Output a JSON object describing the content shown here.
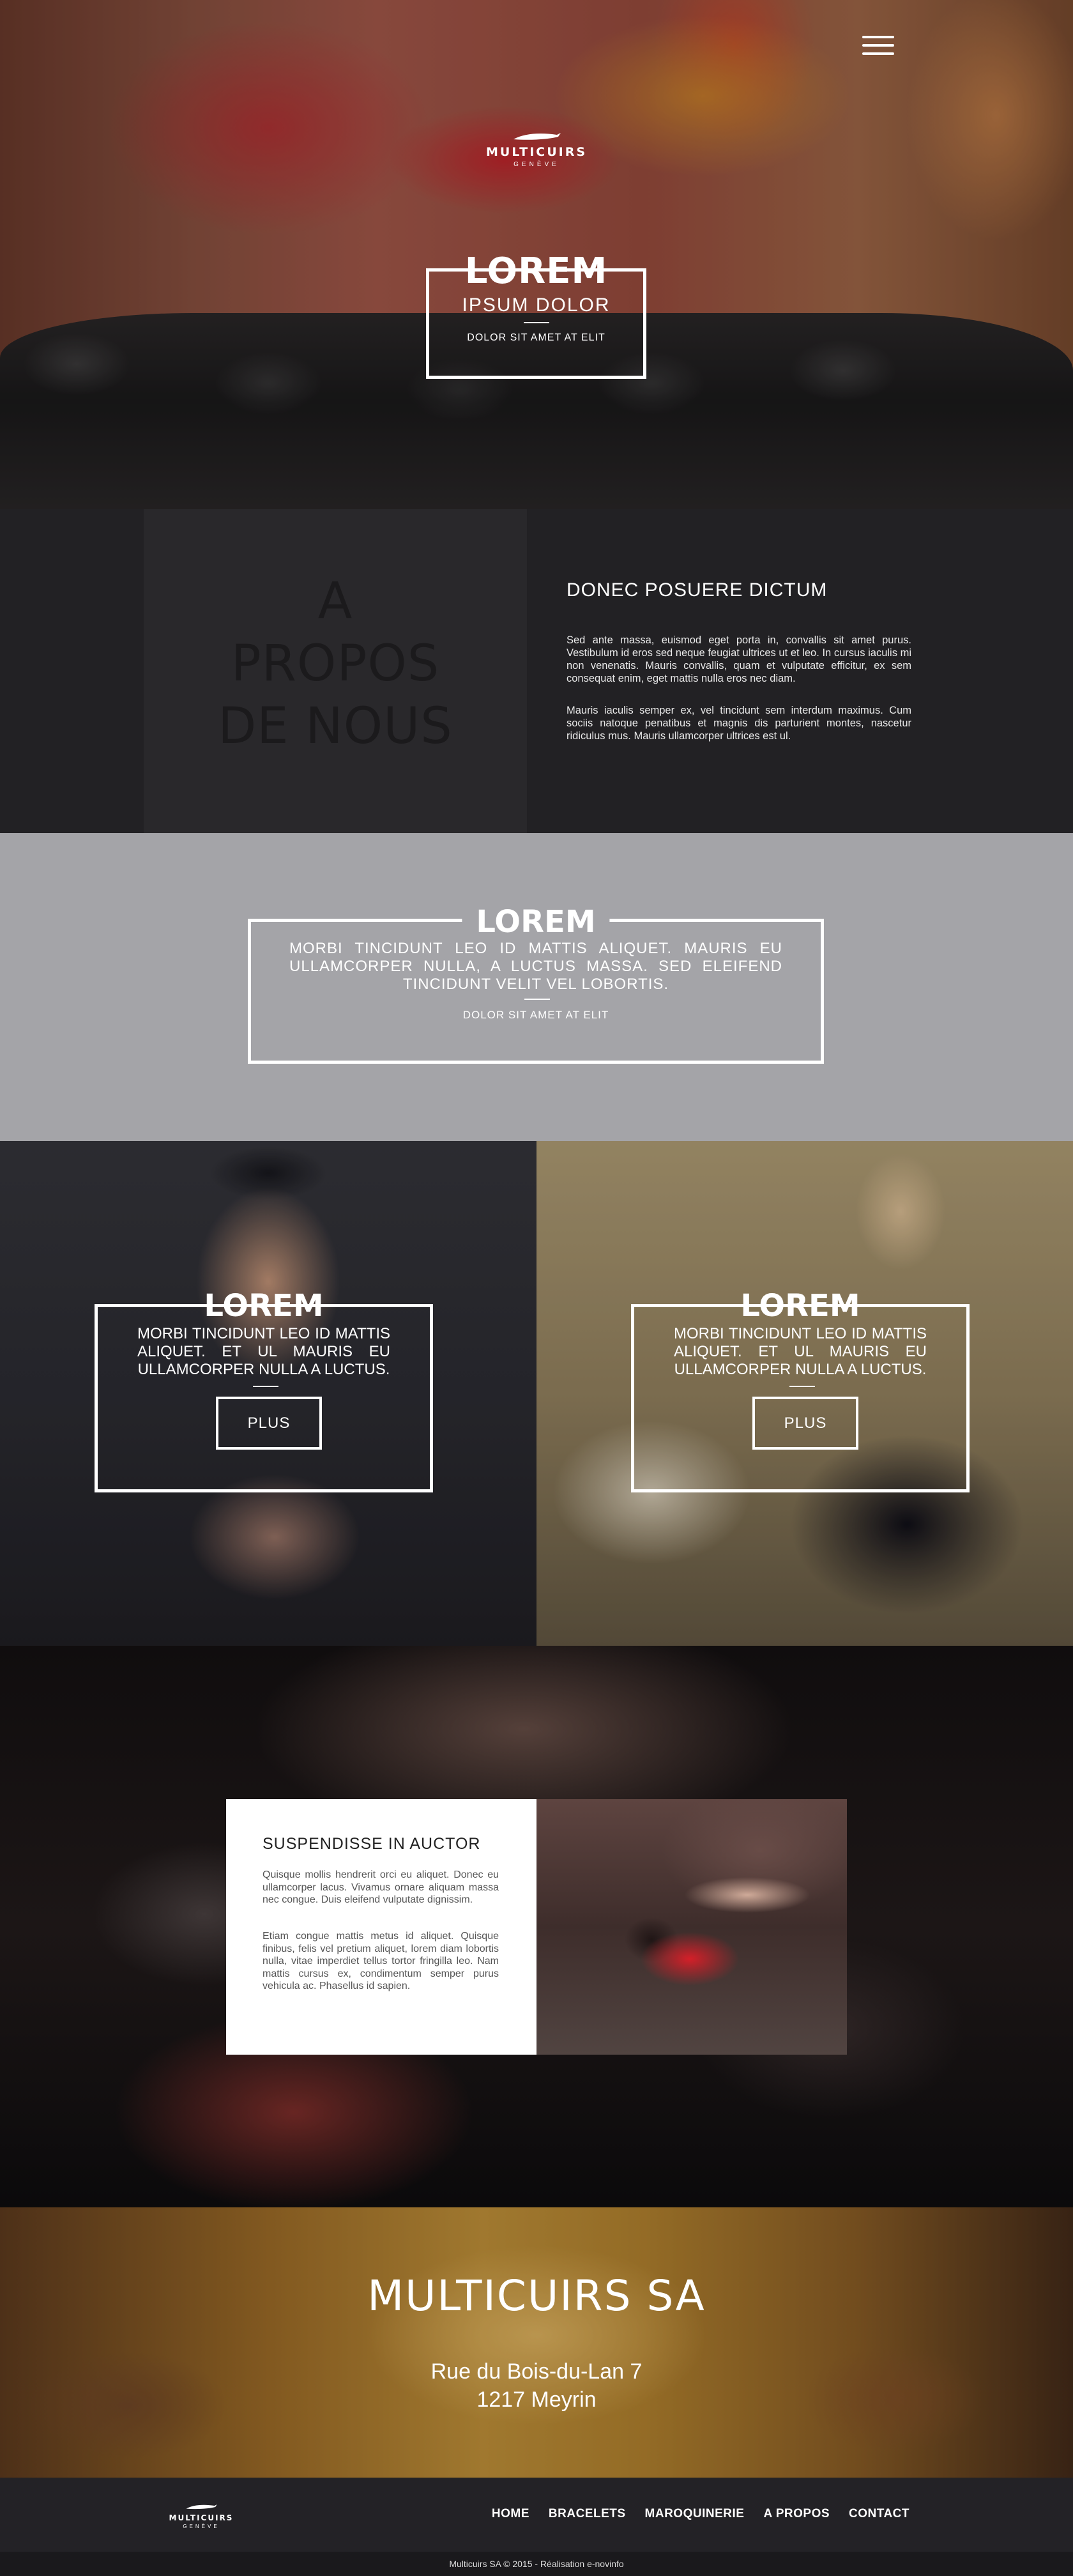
{
  "hero": {
    "menu_icon": "hamburger-icon",
    "logo_name": "MULTICUIRS",
    "logo_sub": "GENÈVE",
    "title": "LOREM",
    "subtitle": "IPSUM DOLOR",
    "caption": "DOLOR SIT AMET AT ELIT"
  },
  "about": {
    "big_text": [
      "A",
      "PROPOS",
      "DE NOUS"
    ],
    "heading": "DONEC POSUERE DICTUM",
    "paragraph1": "Sed ante massa, euismod eget porta in, convallis sit amet purus. Vestibulum id eros sed neque feugiat ultrices ut et leo. In cursus iaculis mi non venenatis. Mauris convallis, quam et vulputate efficitur, ex sem consequat enim, eget mattis nulla eros nec diam.",
    "paragraph2": "Mauris iaculis semper ex, vel tincidunt sem interdum maximus. Cum sociis natoque penatibus et magnis dis parturient montes, nascetur ridiculus mus. Mauris ullamcorper ultrices est ul."
  },
  "quote": {
    "title": "LOREM",
    "text": "MORBI TINCIDUNT LEO ID MATTIS ALIQUET. MAURIS EU ULLAMCORPER NULLA, A LUCTUS MASSA. SED ELEIFEND TINCIDUNT VELIT VEL LOBORTIS.",
    "caption": "DOLOR SIT AMET AT ELIT"
  },
  "tiles": [
    {
      "title": "LOREM",
      "text": "MORBI TINCIDUNT LEO ID MATTIS ALIQUET. ET UL MAURIS EU ULLAMCORPER NULLA A LUCTUS.",
      "button": "PLUS"
    },
    {
      "title": "LOREM",
      "text": "MORBI TINCIDUNT LEO ID MATTIS ALIQUET. ET UL MAURIS EU ULLAMCORPER NULLA A LUCTUS.",
      "button": "PLUS"
    }
  ],
  "article": {
    "heading": "SUSPENDISSE IN AUCTOR",
    "paragraph1": "Quisque mollis hendrerit orci eu aliquet. Donec eu ullamcorper lacus. Vivamus ornare aliquam massa nec congue. Duis eleifend vulputate dignissim.",
    "paragraph2": "Etiam congue mattis metus id aliquet. Quisque finibus, felis vel pretium aliquet, lorem diam lobortis nulla, vitae imperdiet tellus tortor fringilla leo. Nam mattis cursus ex, condimentum semper purus vehicula ac. Phasellus id sapien."
  },
  "contact": {
    "company": "MULTICUIRS SA",
    "address_line1": "Rue du Bois-du-Lan 7",
    "address_line2": "1217 Meyrin"
  },
  "footer": {
    "logo_name": "MULTICUIRS",
    "logo_sub": "GENÈVE",
    "nav": [
      "HOME",
      "BRACELETS",
      "MAROQUINERIE",
      "A PROPOS",
      "CONTACT"
    ],
    "copyright": "Multicuirs SA © 2015 - Réalisation e-novinfo"
  }
}
